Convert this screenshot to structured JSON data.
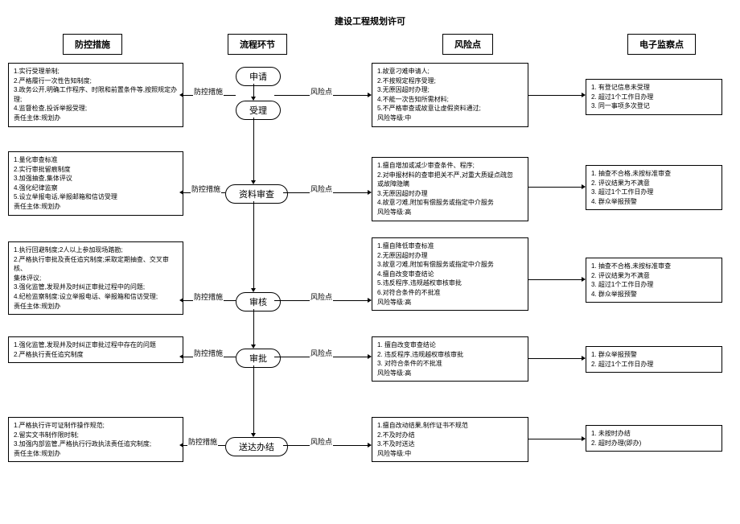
{
  "title": "建设工程规划许可",
  "headers": {
    "h1": "防控措施",
    "h2": "流程环节",
    "h3": "风险点",
    "h4": "电子监察点"
  },
  "flow": {
    "n1": "申请",
    "n2": "受理",
    "n3": "资料审查",
    "n4": "审核",
    "n5": "审批",
    "n6": "送达办结"
  },
  "labels": {
    "fk": "防控措施",
    "fx": "风险点"
  },
  "left": {
    "b1": "1.实行受理单制;\n2.严格履行一次性告知制度;\n3.政务公开,明确工作程序、时限和前置条件等,按照规定办理;\n4.监督检查,投诉举报受理;\n责任主体:规划办",
    "b2": "1.量化审查标准\n2.实行审批留痕制度\n3.加强抽查,集体评议\n4.强化纪律监察\n5.设立举报电话,举报邮箱和信访受理\n责任主体:规划办",
    "b3": "1.执行回避制度;2人以上参加现场踏勘;\n2.严格执行审批及责任追究制度;采取定期抽查、交叉审核、\n集体评议;\n3.强化监管,发现并及时纠正审批过程中的问题;\n4.纪检监察制度:设立举报电话、举报箱和信访受理;\n责任主体:规划办",
    "b4": "1.强化监管,发现并及时纠正审批过程中存在的问题\n2.严格执行责任追究制度",
    "b5": "1.严格执行许可证制作操作规范;\n2.留实文书制作限时制;\n3.加强内部监管,严格执行行政执法责任追究制度;\n责任主体:规划办"
  },
  "risk": {
    "b1": "1.故意刁难申请人;\n2.不按规定程序受理;\n3.无原因超时办理;\n4.不能一次告知所需材料;\n5.不严格审查或故意让虚假资料通过;\n风险等级:中",
    "b2": "1.擅自增加或减少审查条件、程序;\n2.对申报材料的查审把关不严,对重大质疑点疏忽\n或故障隐瞒\n3.无原因超时办理\n4.故意刁难,附加有偿服务或指定中介服务\n风险等级:高",
    "b3": "1.擅自降低审查标准\n2.无原因超时办理\n3.故意刁难,附加有偿服务或指定中介服务\n4.擅自改变审查结论\n5.违反程序,违规越权审核审批\n6.对符合条件的不批准\n风险等级:高",
    "b4_1": "擅自改变审查结论",
    "b4_2": "违反程序,违规越权审核审批",
    "b4_3": "对符合条件的不批准",
    "b4_level": "风险等级:高",
    "b5": "1.擅自改动结果,制作证书不规范\n2.不及时办结\n3.不及时送达\n风险等级:中"
  },
  "elec": {
    "b1_1": "有登记信息未受理",
    "b1_2": "超过1个工作日办理",
    "b1_3": "同一事项多次登记",
    "b2_1": "抽查不合格,未按标准审查",
    "b2_2": "评议结果为不满意",
    "b2_3": "超过1个工作日办理",
    "b2_4": "群众举报预警",
    "b3_1": "抽查不合格,未按标准审查",
    "b3_2": "评议结果为不满意",
    "b3_3": "超过1个工作日办理",
    "b3_4": "群众举报预警",
    "b4_1": "群众举报预警",
    "b4_2": "超过1个工作日办理",
    "b5_1": "未按时办结",
    "b5_2": "超时办理(即办)"
  }
}
